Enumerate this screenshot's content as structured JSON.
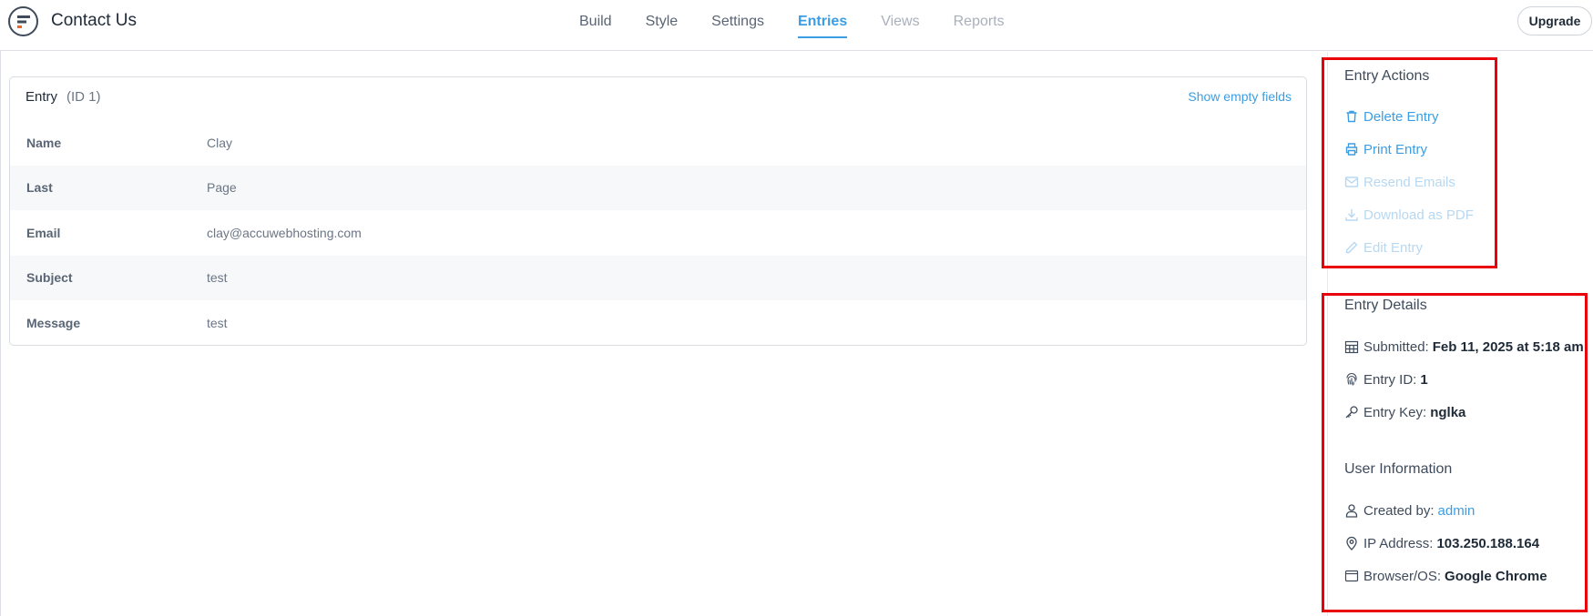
{
  "header": {
    "title": "Contact Us",
    "tabs": [
      {
        "label": "Build",
        "state": "normal"
      },
      {
        "label": "Style",
        "state": "normal"
      },
      {
        "label": "Settings",
        "state": "normal"
      },
      {
        "label": "Entries",
        "state": "active"
      },
      {
        "label": "Views",
        "state": "disabled"
      },
      {
        "label": "Reports",
        "state": "disabled"
      }
    ],
    "upgrade_label": "Upgrade"
  },
  "entry": {
    "title": "Entry",
    "id_label": "(ID 1)",
    "show_empty_label": "Show empty fields",
    "fields": [
      {
        "label": "Name",
        "value": "Clay"
      },
      {
        "label": "Last",
        "value": "Page"
      },
      {
        "label": "Email",
        "value": "clay@accuwebhosting.com"
      },
      {
        "label": "Subject",
        "value": "test"
      },
      {
        "label": "Message",
        "value": "test"
      }
    ]
  },
  "entry_actions": {
    "title": "Entry Actions",
    "items": [
      {
        "label": "Delete Entry",
        "icon": "trash-icon",
        "enabled": true
      },
      {
        "label": "Print Entry",
        "icon": "printer-icon",
        "enabled": true
      },
      {
        "label": "Resend Emails",
        "icon": "envelope-icon",
        "enabled": false
      },
      {
        "label": "Download as PDF",
        "icon": "download-icon",
        "enabled": false
      },
      {
        "label": "Edit Entry",
        "icon": "pencil-icon",
        "enabled": false
      }
    ]
  },
  "entry_details": {
    "title": "Entry Details",
    "submitted_label": "Submitted:",
    "submitted_value": "Feb 11, 2025 at 5:18 am",
    "entry_id_label": "Entry ID:",
    "entry_id_value": "1",
    "entry_key_label": "Entry Key:",
    "entry_key_value": "nglka"
  },
  "user_information": {
    "title": "User Information",
    "created_by_label": "Created by:",
    "created_by_value": "admin",
    "ip_label": "IP Address:",
    "ip_value": "103.250.188.164",
    "browser_label": "Browser/OS:",
    "browser_value": "Google Chrome"
  },
  "colors": {
    "accent": "#3b9ee4",
    "highlight": "#e8000b"
  }
}
